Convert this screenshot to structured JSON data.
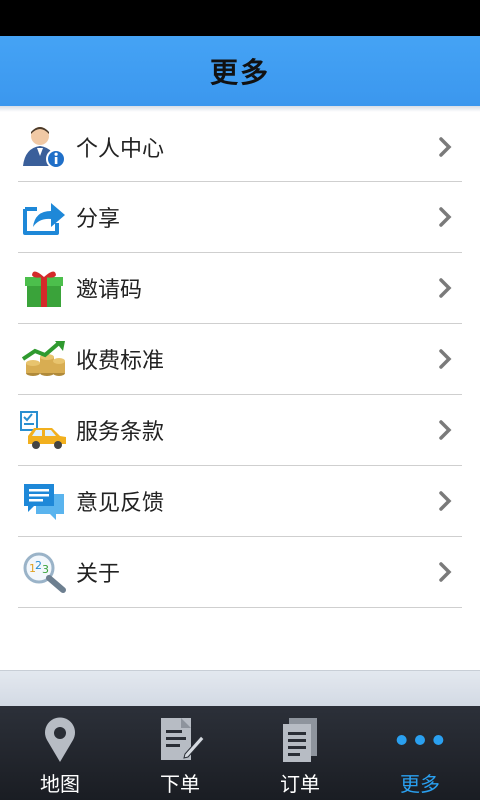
{
  "header": {
    "title": "更多"
  },
  "menu": [
    {
      "label": "个人中心",
      "icon": "user-info-icon"
    },
    {
      "label": "分享",
      "icon": "share-icon"
    },
    {
      "label": "邀请码",
      "icon": "gift-icon"
    },
    {
      "label": "收费标准",
      "icon": "price-chart-icon"
    },
    {
      "label": "服务条款",
      "icon": "terms-car-icon"
    },
    {
      "label": "意见反馈",
      "icon": "feedback-chat-icon"
    },
    {
      "label": "关于",
      "icon": "about-magnifier-icon"
    }
  ],
  "tabs": [
    {
      "label": "地图",
      "icon": "map-pin-icon",
      "active": false
    },
    {
      "label": "下单",
      "icon": "edit-document-icon",
      "active": false
    },
    {
      "label": "订单",
      "icon": "orders-document-icon",
      "active": false
    },
    {
      "label": "更多",
      "icon": "more-dots-icon",
      "active": true
    }
  ],
  "colors": {
    "header": "#3b97ee",
    "active_tab": "#2aa0f0",
    "tabbar": "#23272e"
  }
}
